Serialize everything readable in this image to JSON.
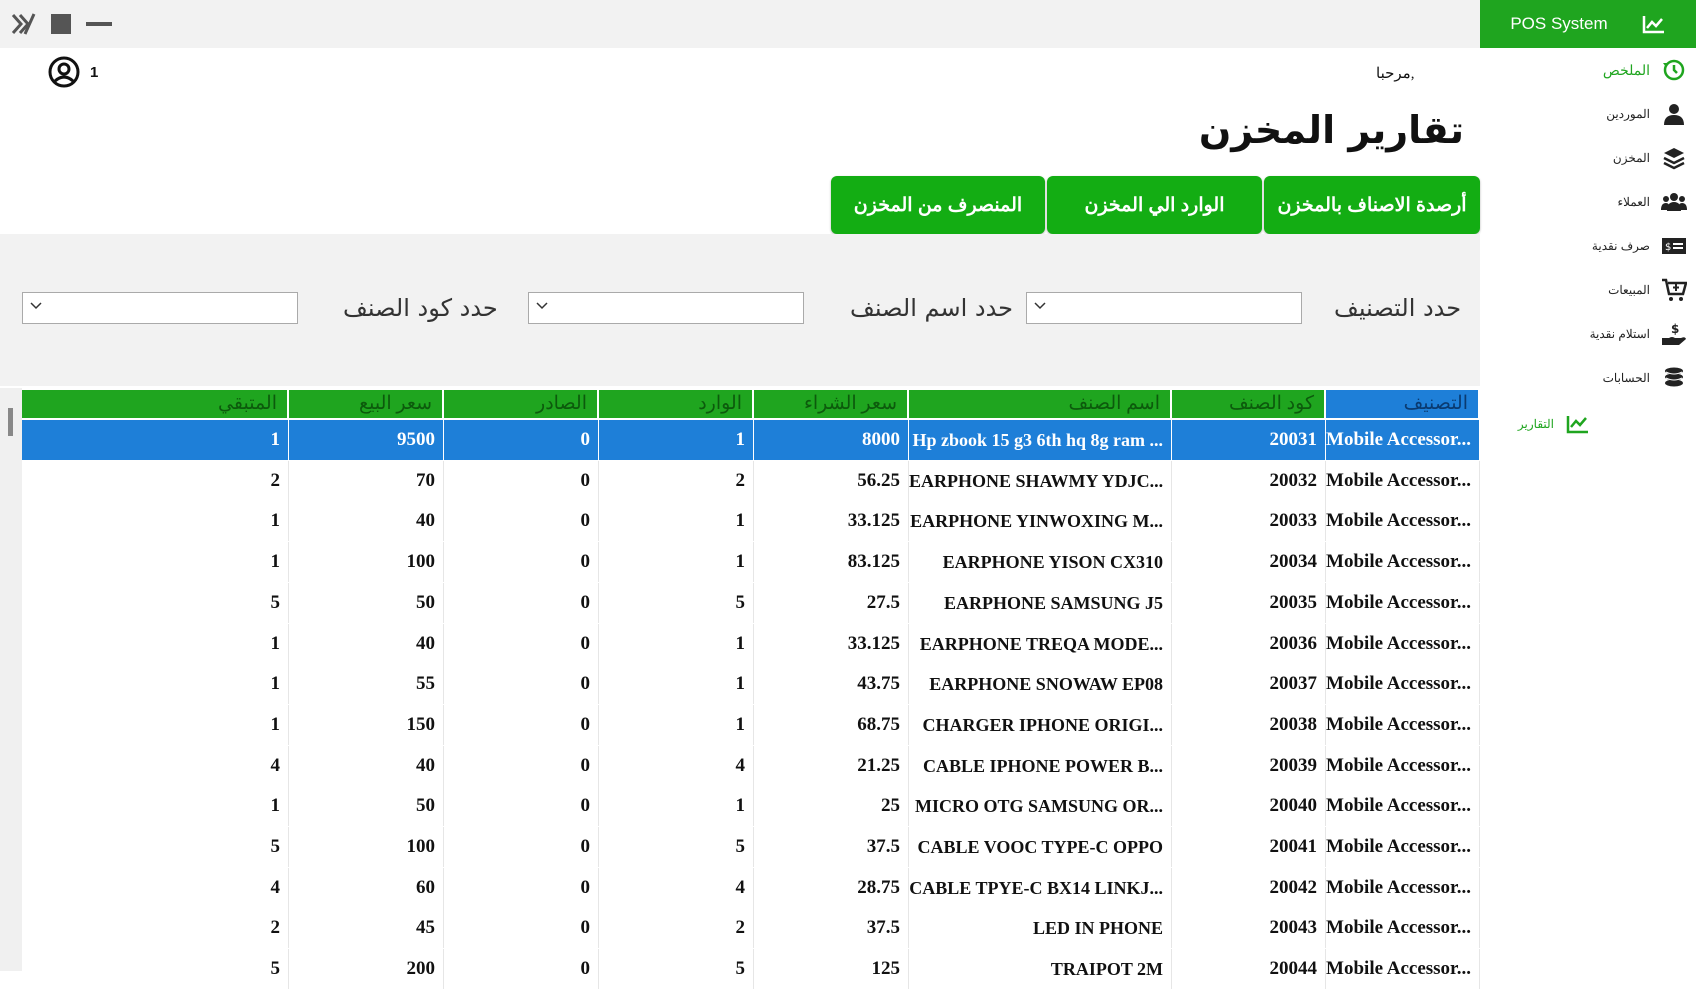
{
  "app": {
    "brand": "POS  System",
    "user_count": "1",
    "welcome": "مرحبا,",
    "title": "تقارير المخزن"
  },
  "sidebar": [
    {
      "label": "الملخص",
      "icon": "history-icon",
      "active": true
    },
    {
      "label": "الموردين",
      "icon": "suppliers-icon"
    },
    {
      "label": "المخزن",
      "icon": "layers-icon"
    },
    {
      "label": "العملاء",
      "icon": "customers-icon"
    },
    {
      "label": "صرف نقدية",
      "icon": "cash-out-icon"
    },
    {
      "label": "المبيعات",
      "icon": "cart-icon"
    },
    {
      "label": "استلام نقدية",
      "icon": "cash-in-icon"
    },
    {
      "label": "الحسابات",
      "icon": "coins-icon"
    },
    {
      "label": "التقارير",
      "icon": "chart-icon",
      "active": true
    }
  ],
  "tabs": [
    {
      "label": "أرصدة الاصناف بالمخزن"
    },
    {
      "label": "الوارد الي المخزن"
    },
    {
      "label": "المنصرف من المخزن"
    }
  ],
  "filters": {
    "category_label": "حدد التصنيف",
    "item_name_label": "حدد اسم الصنف",
    "item_code_label": "حدد كود الصنف"
  },
  "table": {
    "columns": [
      "التصنيف",
      "كود الصنف",
      "اسم الصنف",
      "سعر الشراء",
      "الوارد",
      "الصادر",
      "سعر البيع",
      "المتبقي"
    ],
    "rows": [
      [
        "Mobile Accessor...",
        "20031",
        "Hp zbook 15 g3 6th hq 8g ram ...",
        "8000",
        "1",
        "0",
        "9500",
        "1"
      ],
      [
        "Mobile Accessor...",
        "20032",
        "EARPHONE SHAWMY YDJC...",
        "56.25",
        "2",
        "0",
        "70",
        "2"
      ],
      [
        "Mobile Accessor...",
        "20033",
        "EARPHONE YINWOXING M...",
        "33.125",
        "1",
        "0",
        "40",
        "1"
      ],
      [
        "Mobile Accessor...",
        "20034",
        "EARPHONE YISON CX310",
        "83.125",
        "1",
        "0",
        "100",
        "1"
      ],
      [
        "Mobile Accessor...",
        "20035",
        "EARPHONE SAMSUNG J5",
        "27.5",
        "5",
        "0",
        "50",
        "5"
      ],
      [
        "Mobile Accessor...",
        "20036",
        "EARPHONE TREQA MODE...",
        "33.125",
        "1",
        "0",
        "40",
        "1"
      ],
      [
        "Mobile Accessor...",
        "20037",
        "EARPHONE SNOWAW EP08",
        "43.75",
        "1",
        "0",
        "55",
        "1"
      ],
      [
        "Mobile Accessor...",
        "20038",
        "CHARGER IPHONE ORIGI...",
        "68.75",
        "1",
        "0",
        "150",
        "1"
      ],
      [
        "Mobile Accessor...",
        "20039",
        "CABLE IPHONE POWER B...",
        "21.25",
        "4",
        "0",
        "40",
        "4"
      ],
      [
        "Mobile Accessor...",
        "20040",
        "MICRO OTG SAMSUNG OR...",
        "25",
        "1",
        "0",
        "50",
        "1"
      ],
      [
        "Mobile Accessor...",
        "20041",
        "CABLE VOOC TYPE-C OPPO",
        "37.5",
        "5",
        "0",
        "100",
        "5"
      ],
      [
        "Mobile Accessor...",
        "20042",
        "CABLE TPYE-C BX14 LINKJ...",
        "28.75",
        "4",
        "0",
        "60",
        "4"
      ],
      [
        "Mobile Accessor...",
        "20043",
        "LED IN PHONE",
        "37.5",
        "2",
        "0",
        "45",
        "2"
      ],
      [
        "Mobile Accessor...",
        "20044",
        "TRAIPOT 2M",
        "125",
        "5",
        "0",
        "200",
        "5"
      ]
    ]
  }
}
